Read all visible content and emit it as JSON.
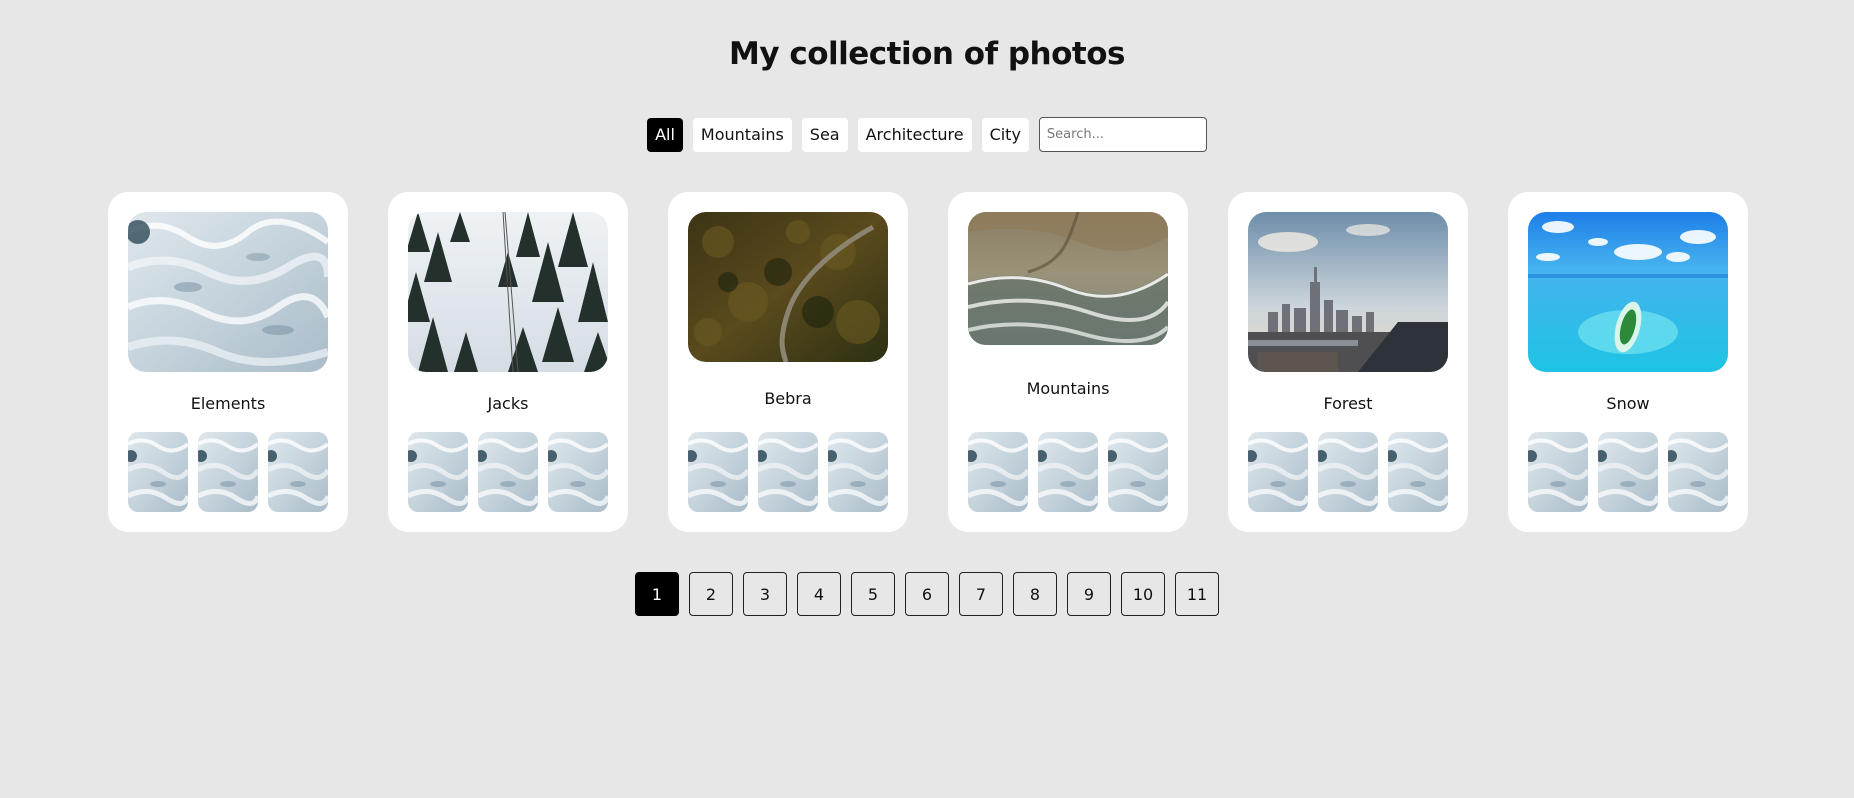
{
  "header": {
    "title": "My collection of photos"
  },
  "filters": {
    "items": [
      {
        "label": "All",
        "active": true
      },
      {
        "label": "Mountains",
        "active": false
      },
      {
        "label": "Sea",
        "active": false
      },
      {
        "label": "Architecture",
        "active": false
      },
      {
        "label": "City",
        "active": false
      }
    ],
    "search_placeholder": "Search...",
    "search_value": ""
  },
  "cards": [
    {
      "title": "Elements",
      "image": "sea-waves-photo"
    },
    {
      "title": "Jacks",
      "image": "snowy-forest-photo"
    },
    {
      "title": "Bebra",
      "image": "forest-road-photo"
    },
    {
      "title": "Mountains",
      "image": "beach-aerial-photo"
    },
    {
      "title": "Forest",
      "image": "city-skyline-photo"
    },
    {
      "title": "Snow",
      "image": "tropical-island-photo"
    }
  ],
  "thumbnail_image": "sea-waves-thumbnail",
  "pagination": {
    "pages": [
      "1",
      "2",
      "3",
      "4",
      "5",
      "6",
      "7",
      "8",
      "9",
      "10",
      "11"
    ],
    "current": "1"
  },
  "colors": {
    "background": "#e7e7e7",
    "active": "#000000",
    "card": "#ffffff"
  }
}
